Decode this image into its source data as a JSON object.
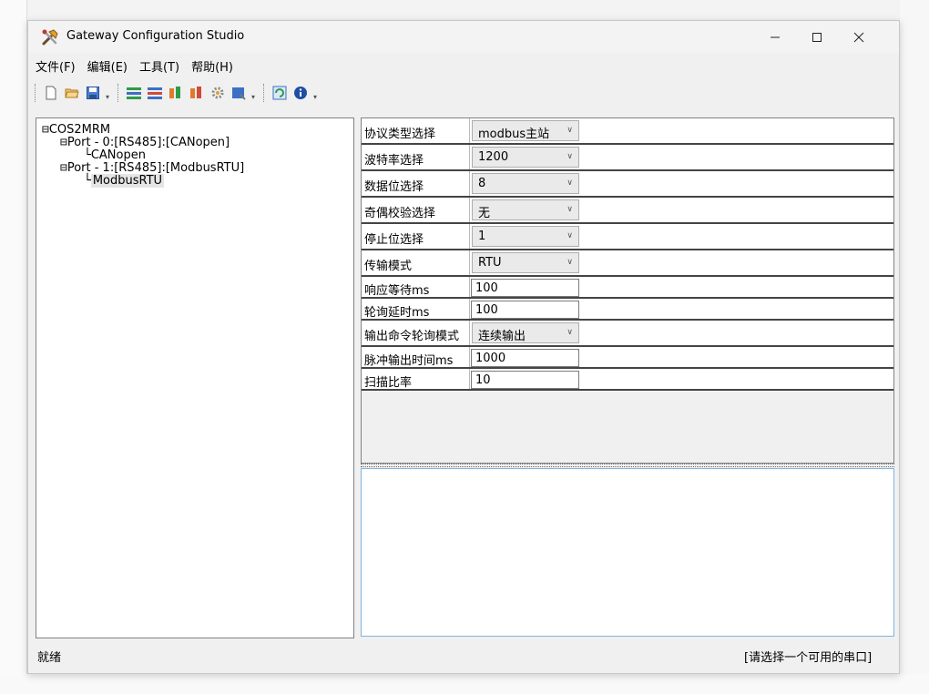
{
  "window": {
    "title": "Gateway Configuration Studio"
  },
  "controls": {
    "minimize": "—",
    "maximize": "☐",
    "close": "✕"
  },
  "menu": [
    {
      "label": "文件(F)"
    },
    {
      "label": "编辑(E)"
    },
    {
      "label": "工具(T)"
    },
    {
      "label": "帮助(H)"
    }
  ],
  "toolbar": {
    "buttons": [
      "new-file-icon",
      "open-folder-icon",
      "save-icon",
      "add-port-icon",
      "remove-port-icon",
      "add-node-icon",
      "remove-node-icon",
      "settings-icon",
      "download-icon",
      "refresh-icon",
      "info-icon"
    ]
  },
  "tree": {
    "root": "COS2MRM",
    "port0": "Port - 0:[RS485]:[CANopen]",
    "port0_child": "CANopen",
    "port1": "Port - 1:[RS485]:[ModbusRTU]",
    "port1_child": "ModbusRTU"
  },
  "properties": [
    {
      "label": "协议类型选择",
      "value": "modbus主站",
      "type": "select"
    },
    {
      "label": "波特率选择",
      "value": "1200",
      "type": "select"
    },
    {
      "label": "数据位选择",
      "value": "8",
      "type": "select"
    },
    {
      "label": "奇偶校验选择",
      "value": "无",
      "type": "select"
    },
    {
      "label": "停止位选择",
      "value": "1",
      "type": "select"
    },
    {
      "label": "传输模式",
      "value": "RTU",
      "type": "select"
    },
    {
      "label": "响应等待ms",
      "value": "100",
      "type": "input"
    },
    {
      "label": "轮询延时ms",
      "value": "100",
      "type": "input"
    },
    {
      "label": "输出命令轮询模式",
      "value": "连续输出",
      "type": "select"
    },
    {
      "label": "脉冲输出时间ms",
      "value": "1000",
      "type": "input"
    },
    {
      "label": "扫描比率",
      "value": "10",
      "type": "input"
    }
  ],
  "status": {
    "left": "就绪",
    "right": "[请选择一个可用的串口]"
  },
  "colors": {
    "selected_node_bg": "#e5e5e5",
    "log_border": "#80b3e0"
  }
}
